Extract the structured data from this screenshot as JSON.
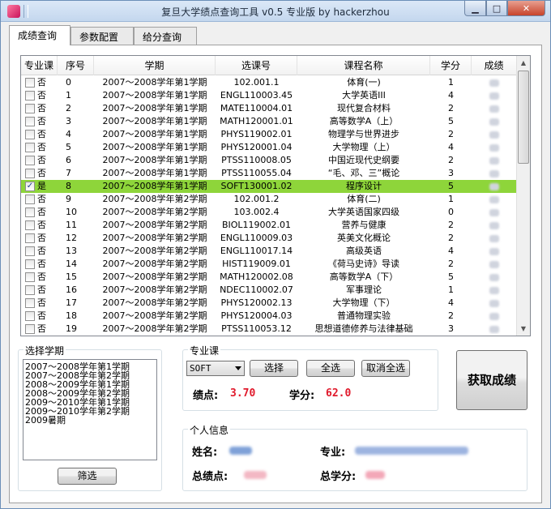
{
  "window": {
    "title": "复旦大学绩点查询工具 v0.5 专业版 by hackerzhou"
  },
  "tabs": [
    "成绩查询",
    "参数配置",
    "给分查询"
  ],
  "grid": {
    "headers": [
      "专业课",
      "序号",
      "学期",
      "选课号",
      "课程名称",
      "学分",
      "成绩"
    ],
    "rows": [
      {
        "checked": false,
        "major": "否",
        "idx": "0",
        "term": "2007～2008学年第1学期",
        "code": "102.001.1",
        "name": "体育(一)",
        "credit": "1"
      },
      {
        "checked": false,
        "major": "否",
        "idx": "1",
        "term": "2007～2008学年第1学期",
        "code": "ENGL110003.45",
        "name": "大学英语III",
        "credit": "4"
      },
      {
        "checked": false,
        "major": "否",
        "idx": "2",
        "term": "2007～2008学年第1学期",
        "code": "MATE110004.01",
        "name": "现代复合材料",
        "credit": "2"
      },
      {
        "checked": false,
        "major": "否",
        "idx": "3",
        "term": "2007～2008学年第1学期",
        "code": "MATH120001.01",
        "name": "高等数学A（上）",
        "credit": "5"
      },
      {
        "checked": false,
        "major": "否",
        "idx": "4",
        "term": "2007～2008学年第1学期",
        "code": "PHYS119002.01",
        "name": "物理学与世界进步",
        "credit": "2"
      },
      {
        "checked": false,
        "major": "否",
        "idx": "5",
        "term": "2007～2008学年第1学期",
        "code": "PHYS120001.04",
        "name": "大学物理（上）",
        "credit": "4"
      },
      {
        "checked": false,
        "major": "否",
        "idx": "6",
        "term": "2007～2008学年第1学期",
        "code": "PTSS110008.05",
        "name": "中国近现代史纲要",
        "credit": "2"
      },
      {
        "checked": false,
        "major": "否",
        "idx": "7",
        "term": "2007～2008学年第1学期",
        "code": "PTSS110055.04",
        "name": "“毛、邓、三”概论",
        "credit": "3"
      },
      {
        "checked": true,
        "major": "是",
        "idx": "8",
        "term": "2007～2008学年第1学期",
        "code": "SOFT130001.02",
        "name": "程序设计",
        "credit": "5",
        "selected": true
      },
      {
        "checked": false,
        "major": "否",
        "idx": "9",
        "term": "2007～2008学年第2学期",
        "code": "102.001.2",
        "name": "体育(二)",
        "credit": "1"
      },
      {
        "checked": false,
        "major": "否",
        "idx": "10",
        "term": "2007～2008学年第2学期",
        "code": "103.002.4",
        "name": "大学英语国家四级",
        "credit": "0"
      },
      {
        "checked": false,
        "major": "否",
        "idx": "11",
        "term": "2007～2008学年第2学期",
        "code": "BIOL119002.01",
        "name": "营养与健康",
        "credit": "2"
      },
      {
        "checked": false,
        "major": "否",
        "idx": "12",
        "term": "2007～2008学年第2学期",
        "code": "ENGL110009.03",
        "name": "英美文化概论",
        "credit": "2"
      },
      {
        "checked": false,
        "major": "否",
        "idx": "13",
        "term": "2007～2008学年第2学期",
        "code": "ENGL110017.14",
        "name": "高级英语",
        "credit": "4"
      },
      {
        "checked": false,
        "major": "否",
        "idx": "14",
        "term": "2007～2008学年第2学期",
        "code": "HIST119009.01",
        "name": "《荷马史诗》导读",
        "credit": "2"
      },
      {
        "checked": false,
        "major": "否",
        "idx": "15",
        "term": "2007～2008学年第2学期",
        "code": "MATH120002.08",
        "name": "高等数学A（下）",
        "credit": "5"
      },
      {
        "checked": false,
        "major": "否",
        "idx": "16",
        "term": "2007～2008学年第2学期",
        "code": "NDEC110002.07",
        "name": "军事理论",
        "credit": "1"
      },
      {
        "checked": false,
        "major": "否",
        "idx": "17",
        "term": "2007～2008学年第2学期",
        "code": "PHYS120002.13",
        "name": "大学物理（下）",
        "credit": "4"
      },
      {
        "checked": false,
        "major": "否",
        "idx": "18",
        "term": "2007～2008学年第2学期",
        "code": "PHYS120004.03",
        "name": "普通物理实验",
        "credit": "2"
      },
      {
        "checked": false,
        "major": "否",
        "idx": "19",
        "term": "2007～2008学年第2学期",
        "code": "PTSS110053.12",
        "name": "思想道德修养与法律基础",
        "credit": "3"
      }
    ]
  },
  "semester_panel": {
    "legend": "选择学期",
    "items": [
      "2007～2008学年第1学期",
      "2007～2008学年第2学期",
      "2008～2009学年第1学期",
      "2008～2009学年第2学期",
      "2009～2010学年第1学期",
      "2009～2010学年第2学期",
      "2009暑期"
    ],
    "filter_button": "筛选"
  },
  "major_panel": {
    "legend": "专业课",
    "combo_value": "SOFT",
    "select_button": "选择",
    "select_all_button": "全选",
    "deselect_all_button": "取消全选",
    "gpa_label": "绩点:",
    "gpa_value": "3.70",
    "credit_label": "学分:",
    "credit_value": "62.0"
  },
  "fetch_button": "获取成绩",
  "personal": {
    "legend": "个人信息",
    "name_label": "姓名:",
    "major_label": "专业:",
    "total_gpa_label": "总绩点:",
    "total_credit_label": "总学分:"
  },
  "colors": {
    "selection": "#8ed53a",
    "value_red": "#e0192b",
    "close_red": "#c7432b"
  }
}
